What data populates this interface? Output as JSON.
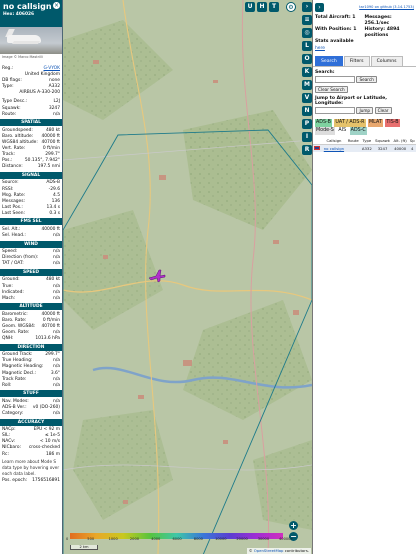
{
  "aircraft": {
    "callsign": "no callsign",
    "hex_label": "Hex:",
    "hex": "406026",
    "photo_credit": "Image © Marco Mastrilli",
    "reg": "G-VYOK",
    "country": "United Kingdom",
    "db_flags": "none",
    "type": "A332",
    "type_full": "AIRBUS A-330-200",
    "type_desc": "L2J",
    "squawk": "3247",
    "route": "n/a"
  },
  "labels": {
    "reg": "Reg.:",
    "db_flags": "DB flags:",
    "type": "Type:",
    "type_desc": "Type Desc.:",
    "squawk": "Squawk:",
    "route": "Route:"
  },
  "sections": {
    "spatial": {
      "title": "SPATIAL",
      "rows": [
        {
          "k": "Groundspeed:",
          "v": "480 kt"
        },
        {
          "k": "Baro. altitude:",
          "v": "40000 ft"
        },
        {
          "k": "WGS84 altitude:",
          "v": "40700 ft"
        },
        {
          "k": "Vert. Rate:",
          "v": "0 ft/min"
        },
        {
          "k": "Track:",
          "v": "299.7°"
        },
        {
          "k": "Pos.:",
          "v": "50.135°, 7.942°"
        },
        {
          "k": "Distance:",
          "v": "197.5 nmi"
        }
      ]
    },
    "signal": {
      "title": "SIGNAL",
      "rows": [
        {
          "k": "Source:",
          "v": "ADS-B"
        },
        {
          "k": "RSSI:",
          "v": "-29.6"
        },
        {
          "k": "Msg. Rate:",
          "v": "4.5"
        },
        {
          "k": "Messages:",
          "v": "136"
        },
        {
          "k": "Last Pos.:",
          "v": "13.4 s"
        },
        {
          "k": "Last Seen:",
          "v": "0.3 s"
        }
      ]
    },
    "fms": {
      "title": "FMS SEL",
      "rows": [
        {
          "k": "Sel. Alt.:",
          "v": "40000 ft"
        },
        {
          "k": "Sel. Head.:",
          "v": "n/a"
        }
      ]
    },
    "wind": {
      "title": "WIND",
      "rows": [
        {
          "k": "Speed:",
          "v": "n/a"
        },
        {
          "k": "Direction (from):",
          "v": "n/a"
        },
        {
          "k": "TAT / OAT:",
          "v": "n/a"
        }
      ]
    },
    "speed": {
      "title": "SPEED",
      "rows": [
        {
          "k": "Ground:",
          "v": "480 kt"
        },
        {
          "k": "True:",
          "v": "n/a"
        },
        {
          "k": "Indicated:",
          "v": "n/a"
        },
        {
          "k": "Mach:",
          "v": "n/a"
        }
      ]
    },
    "altitude": {
      "title": "ALTITUDE",
      "rows": [
        {
          "k": "Barometric:",
          "v": "40000 ft"
        },
        {
          "k": "Baro. Rate:",
          "v": "0 ft/min"
        },
        {
          "k": "Geom. WGS84:",
          "v": "40700 ft"
        },
        {
          "k": "Geom. Rate:",
          "v": "n/a"
        },
        {
          "k": "QNH:",
          "v": "1013.6 hPa"
        }
      ]
    },
    "direction": {
      "title": "DIRECTION",
      "rows": [
        {
          "k": "Ground Track:",
          "v": "299.7°"
        },
        {
          "k": "True Heading:",
          "v": "n/a"
        },
        {
          "k": "Magnetic Heading:",
          "v": "n/a"
        },
        {
          "k": "Magnetic Decl.:",
          "v": "3.6°"
        },
        {
          "k": "Track Rate:",
          "v": "n/a"
        },
        {
          "k": "Roll:",
          "v": "n/a"
        }
      ]
    },
    "stuff": {
      "title": "STUFF",
      "rows": [
        {
          "k": "Nav. Modes:",
          "v": "n/a"
        },
        {
          "k": "ADS-B Ver.:",
          "v": "v0 (DO-260)"
        },
        {
          "k": "Category:",
          "v": "n/a"
        }
      ]
    },
    "accuracy": {
      "title": "ACCURACY",
      "rows": [
        {
          "k": "NACp:",
          "v": "EPU < 92 m"
        },
        {
          "k": "SIL:",
          "v": "≤ 1e-5"
        },
        {
          "k": "NACv:",
          "v": "< 10 m/s"
        },
        {
          "k": "NICbaro:",
          "v": "cross-checked"
        },
        {
          "k": "Rc:",
          "v": "186 m"
        }
      ]
    },
    "learn_more": "Learn more about Mode S data type by hovering over each data label.",
    "pos_epoch_label": "Pos. epoch:",
    "pos_epoch": "1756516891"
  },
  "map_buttons": {
    "top": [
      "U",
      "H",
      "T"
    ],
    "side": [
      "L",
      "O",
      "K",
      "M",
      "V",
      "N",
      "P",
      "I",
      "R"
    ]
  },
  "sidebar": {
    "link": "tar1090 on github (3.14.1753)",
    "stats": [
      {
        "label": "Total Aircraft:",
        "value": "1"
      },
      {
        "label": "Messages:",
        "value": "256.1/sec"
      },
      {
        "label": "With Position:",
        "value": "1"
      },
      {
        "label": "History:",
        "value": "4894 positions"
      },
      {
        "label": "Stats available",
        "value": ""
      }
    ],
    "stats_link": "here",
    "tabs": [
      "Search",
      "Filters",
      "Columns"
    ],
    "search_label": "Search:",
    "search_button": "Search",
    "clear_search": "Clear Search",
    "jump_label": "Jump to Airport or Latitude, Longitude:",
    "jump_button": "Jump",
    "clear_button": "Clear",
    "flags": [
      "ADS-B",
      "UAT / ADS-R",
      "MLAT",
      "TIS-B",
      "Mode-S",
      "AIS",
      "ADS-C"
    ],
    "table_headers": [
      "",
      "Callsign",
      "Route",
      "Type",
      "Squawk",
      "Alt. (ft)",
      "Sp"
    ],
    "table_rows": [
      [
        "",
        "no callsign",
        "",
        "A332",
        "3247",
        "40000",
        "4"
      ]
    ]
  },
  "legend": {
    "labels": [
      "0",
      "500",
      "1000",
      "2000",
      "4000",
      "6000",
      "8000",
      "10000",
      "20000",
      "30000",
      "40000+"
    ]
  },
  "scale_label": "2 km",
  "attribution": {
    "prefix": "©",
    "link": "OpenStreetMap",
    "suffix": "contributors."
  },
  "colors": {
    "accent": "#00596b",
    "selected_flag": "#e86f6f",
    "adsb_flag": "#7fd3a0"
  }
}
